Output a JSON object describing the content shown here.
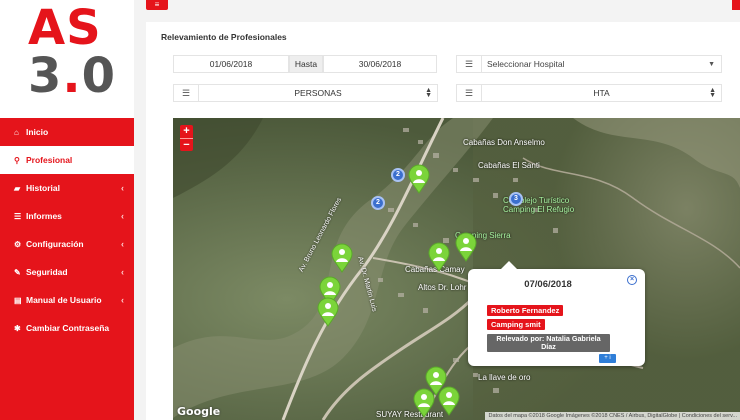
{
  "brand": {
    "logo_line1": "AS",
    "logo_line2_a": "3",
    "logo_dot": ".",
    "logo_line2_b": "0"
  },
  "sidebar": {
    "items": [
      {
        "label": "Inicio",
        "icon": "home-icon",
        "active": false,
        "chevron": false
      },
      {
        "label": "Profesional",
        "icon": "map-marker-icon",
        "active": true,
        "chevron": false
      },
      {
        "label": "Historial",
        "icon": "folder-icon",
        "active": false,
        "chevron": true
      },
      {
        "label": "Informes",
        "icon": "list-icon",
        "active": false,
        "chevron": true
      },
      {
        "label": "Configuración",
        "icon": "gear-icon",
        "active": false,
        "chevron": true
      },
      {
        "label": "Seguridad",
        "icon": "wrench-icon",
        "active": false,
        "chevron": true
      },
      {
        "label": "Manual de Usuario",
        "icon": "book-icon",
        "active": false,
        "chevron": true
      },
      {
        "label": "Cambiar Contraseña",
        "icon": "asterisk-icon",
        "active": false,
        "chevron": false
      }
    ]
  },
  "topbar": {
    "menu_icon": "hamburger-icon"
  },
  "page": {
    "title": "Relevamiento de Profesionales"
  },
  "filters": {
    "date_from": "01/06/2018",
    "date_sep": "Hasta",
    "date_to": "30/06/2018",
    "hospital_placeholder": "Seleccionar Hospital",
    "personas_value": "PERSONAS",
    "hta_value": "HTA"
  },
  "map": {
    "zoom_in": "+",
    "zoom_out": "−",
    "labels": [
      "Cabañas Don Anselmo",
      "Cabañas El Santi",
      "Complejo Turístico Camping El Refugio",
      "Camping Sierra",
      "Cabañas Camay",
      "Altos Dr. Lohr",
      "La llave de oro",
      "SUYAY Restaurant",
      "Av. Bruno Leonardo Flores",
      "Av. Dr. Martin Luis"
    ],
    "clusters": [
      "2",
      "2",
      "3"
    ],
    "google_logo": "Google",
    "attribution": "Datos del mapa ©2018 Google Imágenes ©2018 CNES / Airbus, DigitalGlobe | Condiciones del serv..."
  },
  "popup": {
    "date": "07/06/2018",
    "person": "Roberto Fernandez",
    "place": "Camping smit",
    "surveyor": "Relevado por: Natalia Gabriela Díaz",
    "more_button": "+ i",
    "close_icon": "close-circle-icon"
  },
  "colors": {
    "brand_red": "#e5141b",
    "pin_green": "#7bd43a",
    "cluster_blue": "#3b6fce",
    "tag_dark": "#666666"
  }
}
